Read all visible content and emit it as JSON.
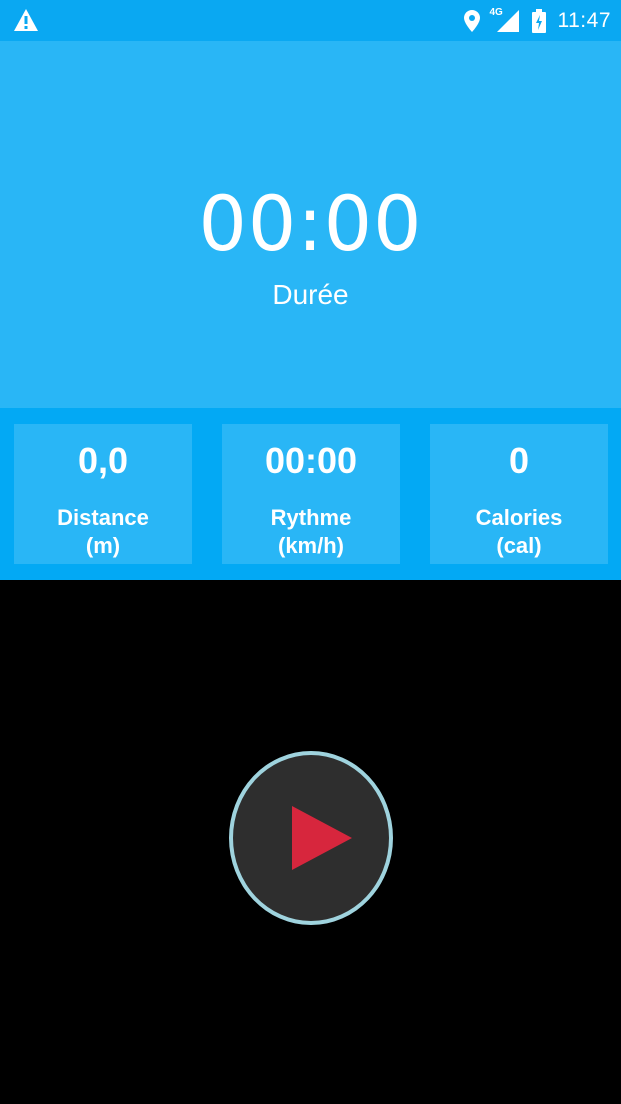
{
  "status_bar": {
    "time": "11:47",
    "network": "4G",
    "icons": [
      "warning-icon",
      "location-icon",
      "signal-icon",
      "battery-icon"
    ]
  },
  "duration": {
    "value": "00:00",
    "label": "Durée"
  },
  "stats": [
    {
      "value": "0,0",
      "label": "Distance",
      "unit": "(m)"
    },
    {
      "value": "00:00",
      "label": "Rythme",
      "unit": "(km/h)"
    },
    {
      "value": "0",
      "label": "Calories",
      "unit": "(cal)"
    }
  ],
  "controls": {
    "play_icon": "play-icon"
  },
  "colors": {
    "status_bar": "#0AA8F2",
    "panel": "#29B6F6",
    "strip": "#03A9F4",
    "play_triangle": "#D7263D",
    "play_ring": "#9FD3DE",
    "play_bg": "#2E2E2E",
    "background": "#000000"
  }
}
